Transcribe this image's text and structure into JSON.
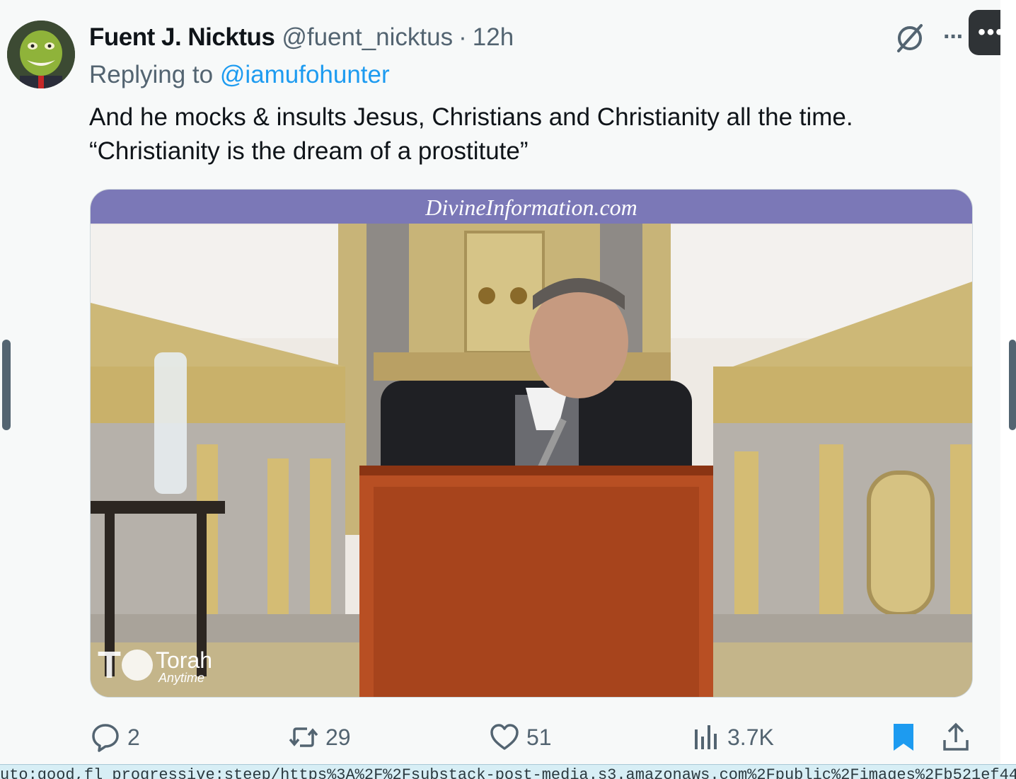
{
  "tweet": {
    "display_name": "Fuent J. Nicktus",
    "handle": "@fuent_nicktus",
    "separator": "·",
    "time": "12h",
    "replying_prefix": "Replying to ",
    "replying_handle": "@iamufohunter",
    "text_line1": "And he mocks & insults Jesus, Christians and Christianity all the time.",
    "text_line2": "“Christianity is the dream of a prostitute”"
  },
  "top_controls": {
    "grok_icon": "grok-slash-icon",
    "more_dots": "···",
    "more_button": "•••"
  },
  "media": {
    "watermark_top": "DivineInformation.com",
    "watermark_logo_big": "Torah",
    "watermark_logo_small": "Anytime"
  },
  "actions": {
    "reply_count": "2",
    "repost_count": "29",
    "like_count": "51",
    "view_count": "3.7K"
  },
  "colors": {
    "accent": "#1d9bf0",
    "muted": "#536471",
    "bookmark_active": "#1d9bf0"
  },
  "status_bar": {
    "url": "uto:good,fl_progressive:steep/https%3A%2F%2Fsubstack-post-media.s3.amazonaws.com%2Fpublic%2Fimages%2Fb521ef44"
  }
}
